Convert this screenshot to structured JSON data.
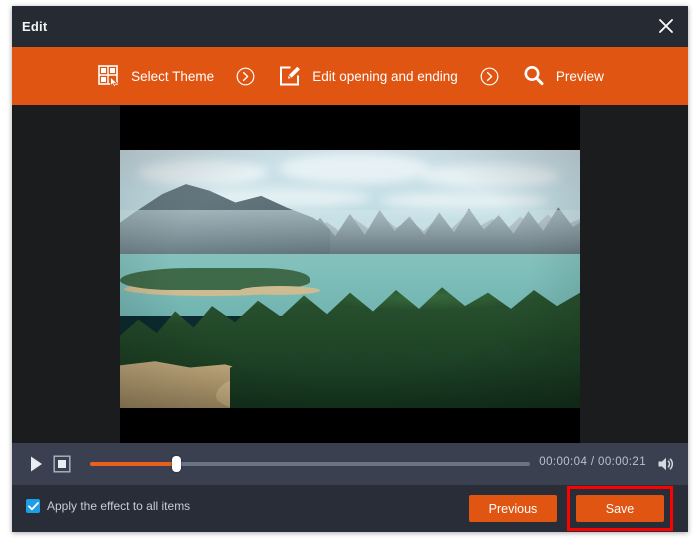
{
  "window": {
    "title": "Edit",
    "close_icon": "close-icon"
  },
  "toolbar": {
    "items": [
      {
        "label": "Select Theme",
        "icon": "theme-grid-cursor-icon"
      },
      {
        "label": "Edit opening and ending",
        "icon": "edit-pencil-square-icon"
      },
      {
        "label": "Preview",
        "icon": "magnifier-icon"
      }
    ],
    "separator_icon": "chevron-right-circle-icon",
    "accent_color": "#e05512"
  },
  "player": {
    "play_icon": "play-icon",
    "stop_icon": "stop-icon",
    "volume_icon": "speaker-icon",
    "current_time": "00:00:04",
    "separator": "/",
    "total_time": "00:00:21",
    "time_display": "00:00:04 / 00:00:21",
    "progress_percent": 19,
    "seek_fill_color": "#e8601b",
    "seek_track_color": "#6b7384"
  },
  "footer": {
    "checkbox": {
      "label": "Apply the effect to all items",
      "checked": true,
      "color": "#1e9ee8"
    },
    "previous_label": "Previous",
    "save_label": "Save",
    "highlight_color": "#ff0000"
  },
  "preview": {
    "description": "Aerial landscape video frame: turquoise lake with limestone karst mountains, dense green forest and sandy shoreline",
    "letterbox_color": "#000000",
    "stage_color": "#1b1c1e"
  }
}
